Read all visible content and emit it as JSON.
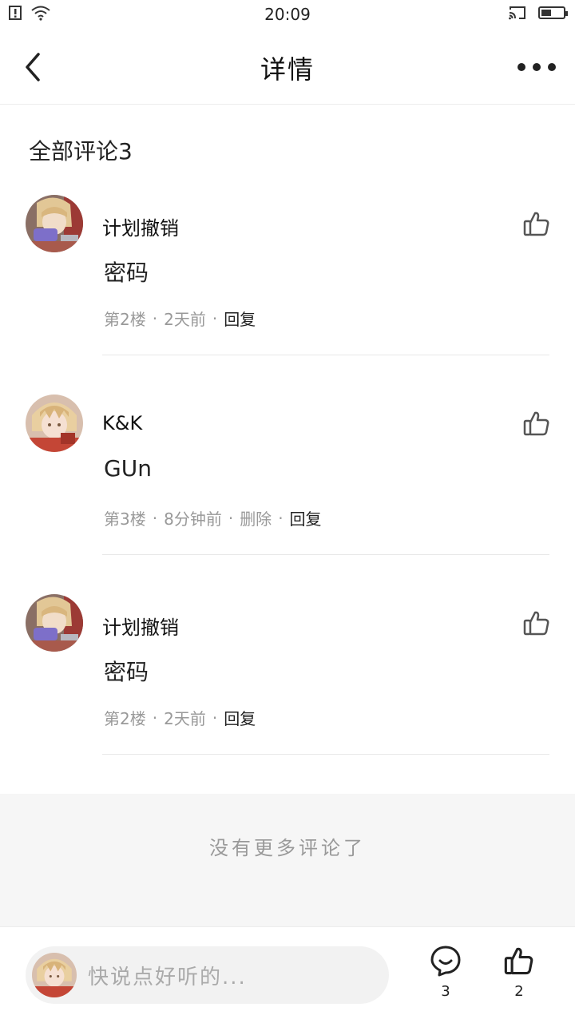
{
  "status_bar": {
    "time": "20:09",
    "battery_level": 0.45,
    "icons": [
      "alert-icon",
      "wifi-icon",
      "cast-icon",
      "battery-icon"
    ]
  },
  "nav": {
    "title": "详情",
    "back_icon": "chevron-left-icon",
    "more_icon": "more-horizontal-icon"
  },
  "comments_header": "全部评论3",
  "comments": [
    {
      "name": "计划撤销",
      "text": "密码",
      "floor": "第2楼",
      "time": "2天前",
      "actions": [
        "回复"
      ],
      "avatar": "avatar-blonde"
    },
    {
      "name": "K&K",
      "text": "GUn",
      "floor": "第3楼",
      "time": "8分钟前",
      "actions": [
        "删除",
        "回复"
      ],
      "avatar": "avatar-bun"
    },
    {
      "name": "计划撤销",
      "text": "密码",
      "floor": "第2楼",
      "time": "2天前",
      "actions": [
        "回复"
      ],
      "avatar": "avatar-blonde"
    }
  ],
  "no_more_text": "没有更多评论了",
  "bottom_bar": {
    "input_placeholder": "快说点好听的...",
    "comment_count": "3",
    "like_count": "2"
  },
  "colors": {
    "text_primary": "#222222",
    "text_secondary": "#999999",
    "footer_bg": "#f6f6f6",
    "input_bg": "#f2f2f2"
  }
}
